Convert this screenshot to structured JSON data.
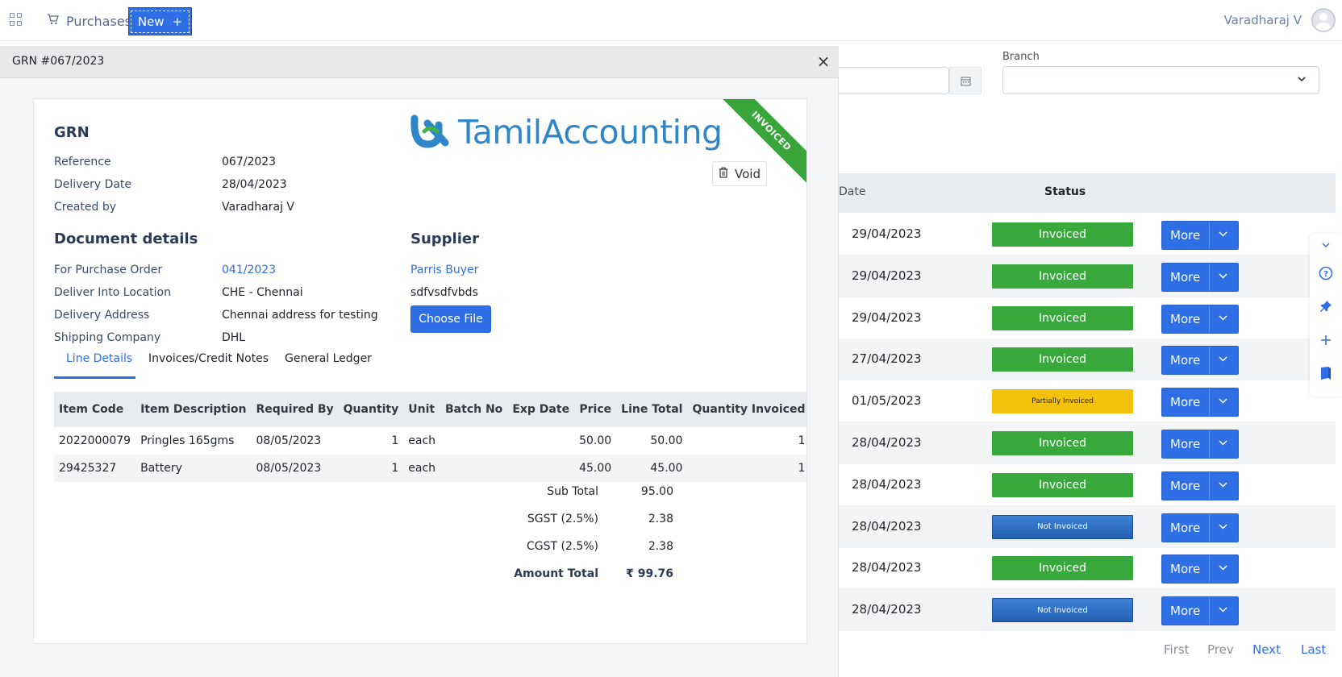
{
  "topbar": {
    "module": "Purchases",
    "new_label": "New",
    "new_plus": "+",
    "user": "Varadharaj V"
  },
  "filters": {
    "branch_label": "Branch"
  },
  "list": {
    "header_date": "Date",
    "header_status": "Status",
    "more_label": "More",
    "rows": [
      {
        "date": "29/04/2023",
        "status": "Invoiced",
        "kind": "inv"
      },
      {
        "date": "29/04/2023",
        "status": "Invoiced",
        "kind": "inv"
      },
      {
        "date": "29/04/2023",
        "status": "Invoiced",
        "kind": "inv"
      },
      {
        "date": "27/04/2023",
        "status": "Invoiced",
        "kind": "inv"
      },
      {
        "date": "01/05/2023",
        "status": "Partially Invoiced",
        "kind": "partial"
      },
      {
        "date": "28/04/2023",
        "status": "Invoiced",
        "kind": "inv"
      },
      {
        "date": "28/04/2023",
        "status": "Invoiced",
        "kind": "inv"
      },
      {
        "date": "28/04/2023",
        "status": "Not Invoiced",
        "kind": "notinv"
      },
      {
        "date": "28/04/2023",
        "status": "Invoiced",
        "kind": "inv"
      },
      {
        "date": "28/04/2023",
        "status": "Not Invoiced",
        "kind": "notinv"
      }
    ],
    "pager": {
      "first": "First",
      "prev": "Prev",
      "next": "Next",
      "last": "Last"
    }
  },
  "modal": {
    "title": "GRN #067/2023",
    "close": "×",
    "logo": {
      "part1": "Tamil",
      "part2": "Accounting"
    },
    "ribbon": "INVOICED",
    "void_label": "Void",
    "heading": "GRN",
    "reference_label": "Reference",
    "reference": "067/2023",
    "delivery_date_label": "Delivery Date",
    "delivery_date": "28/04/2023",
    "created_by_label": "Created by",
    "created_by": "Varadharaj V",
    "doc_details_title": "Document details",
    "po_label": "For Purchase Order",
    "po": "041/2023",
    "location_label": "Deliver Into Location",
    "location": "CHE - Chennai",
    "address_label": "Delivery Address",
    "address": "Chennai address for testing",
    "shipping_label": "Shipping Company",
    "shipping": "DHL",
    "supplier_title": "Supplier",
    "supplier_name": "Parris Buyer",
    "supplier_extra": "sdfvsdfvbds",
    "choose_file": "Choose File",
    "tabs": [
      "Line Details",
      "Invoices/Credit Notes",
      "General Ledger"
    ],
    "table": {
      "headers": [
        "Item Code",
        "Item Description",
        "Required By",
        "Quantity",
        "Unit",
        "Batch No",
        "Exp Date",
        "Price",
        "Line Total",
        "Quantity Invoiced"
      ],
      "rows": [
        {
          "code": "2022000079",
          "desc": "Pringles 165gms",
          "required": "08/05/2023",
          "qty": "1",
          "unit": "each",
          "batch": "",
          "exp": "",
          "price": "50.00",
          "total": "50.00",
          "qinv": "1"
        },
        {
          "code": "29425327",
          "desc": "Battery",
          "required": "08/05/2023",
          "qty": "1",
          "unit": "each",
          "batch": "",
          "exp": "",
          "price": "45.00",
          "total": "45.00",
          "qinv": "1"
        }
      ]
    },
    "totals": {
      "sub_label": "Sub Total",
      "sub": "95.00",
      "sgst_label": "SGST (2.5%)",
      "sgst": "2.38",
      "cgst_label": "CGST (2.5%)",
      "cgst": "2.38",
      "amount_label": "Amount Total",
      "amount": "₹ 99.76"
    }
  },
  "colors": {
    "primary": "#2f6fe6",
    "invoiced": "#3aa93d",
    "partial": "#f4c20d",
    "not_invoiced": "#2f6fc6"
  }
}
